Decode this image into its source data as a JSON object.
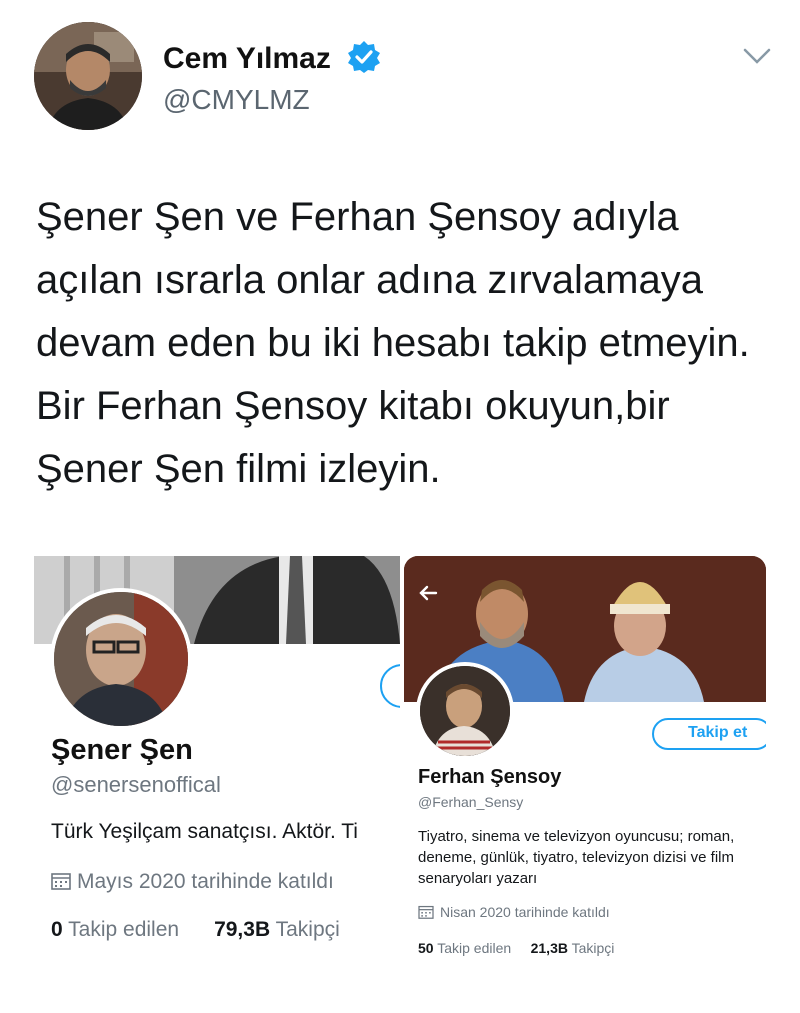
{
  "tweet": {
    "author_name": "Cem Yılmaz",
    "author_handle": "@CMYLMZ",
    "text": "Şener Şen ve Ferhan Şensoy adıyla açılan ısrarla onlar adına zırvalamaya devam eden bu iki hesabı takip etmeyin. Bir Ferhan Şensoy kitabı okuyun,bir Şener Şen filmi izleyin.",
    "verified_color": "#1da1f2"
  },
  "card_left": {
    "name": "Şener Şen",
    "handle": "@senersenoffical",
    "bio": "Türk Yeşilçam sanatçısı. Aktör. Ti",
    "joined": "Mayıs 2020 tarihinde katıldı",
    "following_count": "0",
    "following_label": "Takip edilen",
    "followers_count": "79,3B",
    "followers_label": "Takipçi"
  },
  "card_right": {
    "follow_button": "Takip et",
    "name": "Ferhan Şensoy",
    "handle": "@Ferhan_Sensy",
    "bio": "Tiyatro, sinema ve televizyon oyuncusu; roman, deneme, günlük, tiyatro, televizyon dizisi ve film senaryoları yazarı",
    "joined": "Nisan 2020 tarihinde katıldı",
    "following_count": "50",
    "following_label": "Takip edilen",
    "followers_count": "21,3B",
    "followers_label": "Takipçi"
  },
  "icons": {
    "verified": "verified-badge-icon",
    "menu": "chevron-down-icon",
    "calendar": "calendar-icon",
    "back": "back-arrow-icon"
  }
}
